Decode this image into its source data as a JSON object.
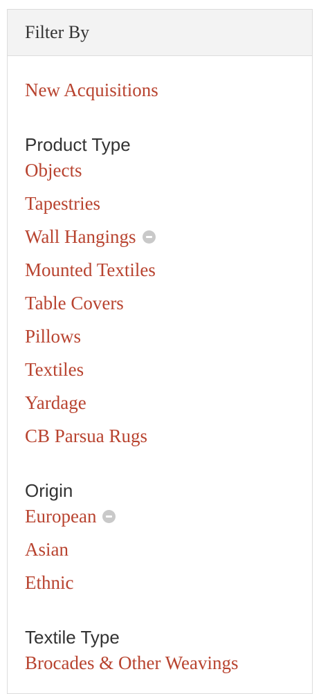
{
  "panel": {
    "title": "Filter By"
  },
  "new_acquisitions": "New Acquisitions",
  "product_type": {
    "heading": "Product Type",
    "items": [
      {
        "label": "Objects"
      },
      {
        "label": "Tapestries"
      },
      {
        "label": "Wall Hangings",
        "icon": "remove-filter-icon"
      },
      {
        "label": "Mounted Textiles"
      },
      {
        "label": "Table Covers"
      },
      {
        "label": "Pillows"
      },
      {
        "label": "Textiles"
      },
      {
        "label": "Yardage"
      },
      {
        "label": "CB Parsua Rugs"
      }
    ]
  },
  "origin": {
    "heading": "Origin",
    "items": [
      {
        "label": "European",
        "icon": "remove-filter-icon"
      },
      {
        "label": "Asian"
      },
      {
        "label": "Ethnic"
      }
    ]
  },
  "textile_type": {
    "heading": "Textile Type",
    "items": [
      {
        "label": "Brocades & Other Weavings"
      }
    ]
  },
  "colors": {
    "link": "#b8432f",
    "text": "#333333",
    "header_bg": "#f3f3f3",
    "icon": "#c9c9c9"
  }
}
